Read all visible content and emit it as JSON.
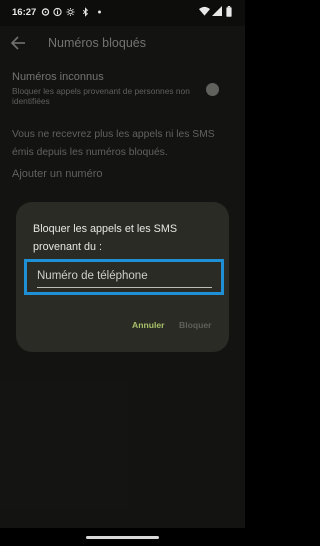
{
  "status_bar": {
    "time": "16:27",
    "icons": [
      "settings-icon",
      "info-icon",
      "brightness-icon",
      "bluetooth-icon",
      "dot-icon",
      "wifi-icon",
      "signal-icon",
      "battery-icon"
    ]
  },
  "app_bar": {
    "title": "Numéros bloqués",
    "back_icon": "arrow-back-icon"
  },
  "unknown_numbers": {
    "title": "Numéros inconnus",
    "summary": "Bloquer les appels provenant de personnes non identifiées"
  },
  "info_text": "Vous ne recevrez plus les appels ni les SMS émis depuis les numéros bloqués.",
  "add_number_label": "Ajouter un numéro",
  "dialog": {
    "title": "Bloquer les appels et les SMS provenant du :",
    "field_placeholder": "Numéro de téléphone",
    "cancel_label": "Annuler",
    "block_label": "Bloquer"
  },
  "colors": {
    "accent": "#a8c06a",
    "focus_highlight": "#1f8fd6",
    "dialog_background": "#2a2b25"
  }
}
